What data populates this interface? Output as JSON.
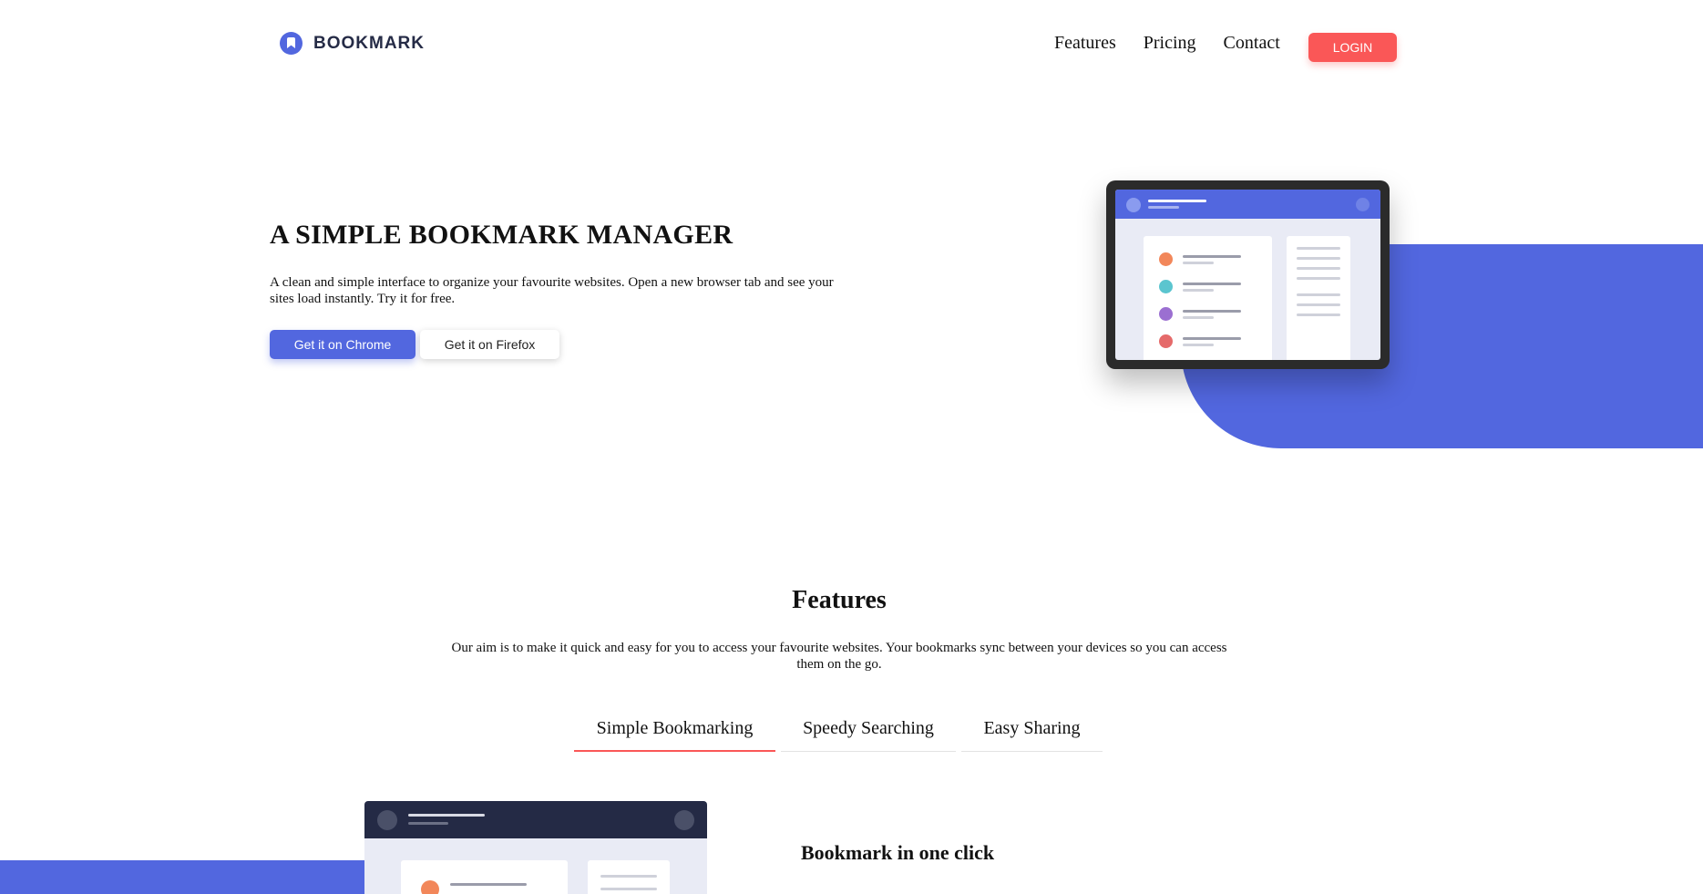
{
  "header": {
    "logo_text": "BOOKMARK",
    "nav": [
      "Features",
      "Pricing",
      "Contact"
    ],
    "login_label": "LOGIN"
  },
  "hero": {
    "title": "A SIMPLE BOOKMARK MANAGER",
    "text": "A clean and simple interface to organize your favourite websites. Open a new browser tab and see your sites load instantly. Try it for free.",
    "chrome_label": "Get it on Chrome",
    "firefox_label": "Get it on Firefox"
  },
  "features": {
    "title": "Features",
    "text": "Our aim is to make it quick and easy for you to access your favourite websites. Your bookmarks sync between your devices so you can access them on the go.",
    "tabs": [
      "Simple Bookmarking",
      "Speedy Searching",
      "Easy Sharing"
    ],
    "active_tab": "Simple Bookmarking",
    "panel_heading": "Bookmark in one click"
  },
  "colors": {
    "primary": "#5267DF",
    "accent": "#FA5757",
    "dark": "#242A45",
    "item_dots": [
      "#F2875A",
      "#5BC5CF",
      "#9B6FD1",
      "#E56A6A"
    ]
  }
}
